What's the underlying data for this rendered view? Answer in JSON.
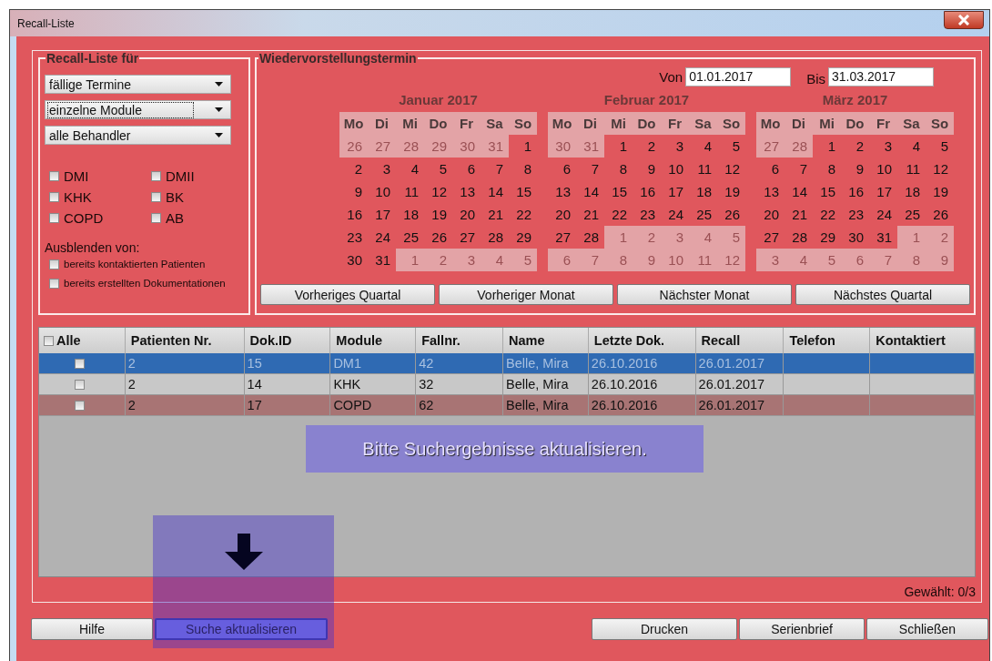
{
  "window": {
    "title": "Recall-Liste"
  },
  "recall_for": {
    "title": "Recall-Liste für",
    "dropdowns": [
      {
        "value": "fällige Termine",
        "focused": false
      },
      {
        "value": "einzelne Module",
        "focused": true
      },
      {
        "value": "alle Behandler",
        "focused": false
      }
    ],
    "modules": [
      {
        "label": "DMI",
        "checked": false
      },
      {
        "label": "DMII",
        "checked": false
      },
      {
        "label": "KHK",
        "checked": false
      },
      {
        "label": "BK",
        "checked": false
      },
      {
        "label": "COPD",
        "checked": false
      },
      {
        "label": "AB",
        "checked": false
      }
    ],
    "hide_label": "Ausblenden von:",
    "hide_options": [
      {
        "label": "bereits kontaktierten Patienten",
        "checked": false
      },
      {
        "label": "bereits erstellten Dokumentationen",
        "checked": false
      }
    ]
  },
  "schedule": {
    "title": "Wiedervorstellungstermin",
    "from_label": "Von",
    "from": "01.01.2017",
    "to_label": "Bis",
    "to": "31.03.2017",
    "months": [
      {
        "title": "Januar 2017",
        "weekdays": [
          "Mo",
          "Di",
          "Mi",
          "Do",
          "Fr",
          "Sa",
          "So"
        ],
        "weeks": [
          [
            {
              "d": "26",
              "in": false
            },
            {
              "d": "27",
              "in": false
            },
            {
              "d": "28",
              "in": false
            },
            {
              "d": "29",
              "in": false
            },
            {
              "d": "30",
              "in": false
            },
            {
              "d": "31",
              "in": false
            },
            {
              "d": "1",
              "in": true
            }
          ],
          [
            {
              "d": "2",
              "in": true
            },
            {
              "d": "3",
              "in": true
            },
            {
              "d": "4",
              "in": true
            },
            {
              "d": "5",
              "in": true
            },
            {
              "d": "6",
              "in": true
            },
            {
              "d": "7",
              "in": true
            },
            {
              "d": "8",
              "in": true
            }
          ],
          [
            {
              "d": "9",
              "in": true
            },
            {
              "d": "10",
              "in": true
            },
            {
              "d": "11",
              "in": true
            },
            {
              "d": "12",
              "in": true
            },
            {
              "d": "13",
              "in": true
            },
            {
              "d": "14",
              "in": true
            },
            {
              "d": "15",
              "in": true
            }
          ],
          [
            {
              "d": "16",
              "in": true
            },
            {
              "d": "17",
              "in": true
            },
            {
              "d": "18",
              "in": true
            },
            {
              "d": "19",
              "in": true
            },
            {
              "d": "20",
              "in": true
            },
            {
              "d": "21",
              "in": true
            },
            {
              "d": "22",
              "in": true
            }
          ],
          [
            {
              "d": "23",
              "in": true
            },
            {
              "d": "24",
              "in": true
            },
            {
              "d": "25",
              "in": true
            },
            {
              "d": "26",
              "in": true
            },
            {
              "d": "27",
              "in": true
            },
            {
              "d": "28",
              "in": true
            },
            {
              "d": "29",
              "in": true
            }
          ],
          [
            {
              "d": "30",
              "in": true
            },
            {
              "d": "31",
              "in": true
            },
            {
              "d": "1",
              "in": false
            },
            {
              "d": "2",
              "in": false
            },
            {
              "d": "3",
              "in": false
            },
            {
              "d": "4",
              "in": false
            },
            {
              "d": "5",
              "in": false
            }
          ]
        ]
      },
      {
        "title": "Februar 2017",
        "weekdays": [
          "Mo",
          "Di",
          "Mi",
          "Do",
          "Fr",
          "Sa",
          "So"
        ],
        "weeks": [
          [
            {
              "d": "30",
              "in": false
            },
            {
              "d": "31",
              "in": false
            },
            {
              "d": "1",
              "in": true
            },
            {
              "d": "2",
              "in": true
            },
            {
              "d": "3",
              "in": true
            },
            {
              "d": "4",
              "in": true
            },
            {
              "d": "5",
              "in": true
            }
          ],
          [
            {
              "d": "6",
              "in": true
            },
            {
              "d": "7",
              "in": true
            },
            {
              "d": "8",
              "in": true
            },
            {
              "d": "9",
              "in": true
            },
            {
              "d": "10",
              "in": true
            },
            {
              "d": "11",
              "in": true
            },
            {
              "d": "12",
              "in": true
            }
          ],
          [
            {
              "d": "13",
              "in": true
            },
            {
              "d": "14",
              "in": true
            },
            {
              "d": "15",
              "in": true
            },
            {
              "d": "16",
              "in": true
            },
            {
              "d": "17",
              "in": true
            },
            {
              "d": "18",
              "in": true
            },
            {
              "d": "19",
              "in": true
            }
          ],
          [
            {
              "d": "20",
              "in": true
            },
            {
              "d": "21",
              "in": true
            },
            {
              "d": "22",
              "in": true
            },
            {
              "d": "23",
              "in": true
            },
            {
              "d": "24",
              "in": true
            },
            {
              "d": "25",
              "in": true
            },
            {
              "d": "26",
              "in": true
            }
          ],
          [
            {
              "d": "27",
              "in": true
            },
            {
              "d": "28",
              "in": true
            },
            {
              "d": "1",
              "in": false
            },
            {
              "d": "2",
              "in": false
            },
            {
              "d": "3",
              "in": false
            },
            {
              "d": "4",
              "in": false
            },
            {
              "d": "5",
              "in": false
            }
          ],
          [
            {
              "d": "6",
              "in": false
            },
            {
              "d": "7",
              "in": false
            },
            {
              "d": "8",
              "in": false
            },
            {
              "d": "9",
              "in": false
            },
            {
              "d": "10",
              "in": false
            },
            {
              "d": "11",
              "in": false
            },
            {
              "d": "12",
              "in": false
            }
          ]
        ]
      },
      {
        "title": "März 2017",
        "weekdays": [
          "Mo",
          "Di",
          "Mi",
          "Do",
          "Fr",
          "Sa",
          "So"
        ],
        "weeks": [
          [
            {
              "d": "27",
              "in": false
            },
            {
              "d": "28",
              "in": false
            },
            {
              "d": "1",
              "in": true
            },
            {
              "d": "2",
              "in": true
            },
            {
              "d": "3",
              "in": true
            },
            {
              "d": "4",
              "in": true
            },
            {
              "d": "5",
              "in": true
            }
          ],
          [
            {
              "d": "6",
              "in": true
            },
            {
              "d": "7",
              "in": true
            },
            {
              "d": "8",
              "in": true
            },
            {
              "d": "9",
              "in": true
            },
            {
              "d": "10",
              "in": true
            },
            {
              "d": "11",
              "in": true
            },
            {
              "d": "12",
              "in": true
            }
          ],
          [
            {
              "d": "13",
              "in": true
            },
            {
              "d": "14",
              "in": true
            },
            {
              "d": "15",
              "in": true
            },
            {
              "d": "16",
              "in": true
            },
            {
              "d": "17",
              "in": true
            },
            {
              "d": "18",
              "in": true
            },
            {
              "d": "19",
              "in": true
            }
          ],
          [
            {
              "d": "20",
              "in": true
            },
            {
              "d": "21",
              "in": true
            },
            {
              "d": "22",
              "in": true
            },
            {
              "d": "23",
              "in": true
            },
            {
              "d": "24",
              "in": true
            },
            {
              "d": "25",
              "in": true
            },
            {
              "d": "26",
              "in": true
            }
          ],
          [
            {
              "d": "27",
              "in": true
            },
            {
              "d": "28",
              "in": true
            },
            {
              "d": "29",
              "in": true
            },
            {
              "d": "30",
              "in": true
            },
            {
              "d": "31",
              "in": true
            },
            {
              "d": "1",
              "in": false
            },
            {
              "d": "2",
              "in": false
            }
          ],
          [
            {
              "d": "3",
              "in": false
            },
            {
              "d": "4",
              "in": false
            },
            {
              "d": "5",
              "in": false
            },
            {
              "d": "6",
              "in": false
            },
            {
              "d": "7",
              "in": false
            },
            {
              "d": "8",
              "in": false
            },
            {
              "d": "9",
              "in": false
            }
          ]
        ]
      }
    ],
    "nav_buttons": [
      "Vorheriges Quartal",
      "Vorheriger Monat",
      "Nächster Monat",
      "Nächstes Quartal"
    ]
  },
  "table": {
    "select_all": {
      "label": "Alle",
      "checked": false
    },
    "columns": [
      "Patienten Nr.",
      "Dok.ID",
      "Module",
      "Fallnr.",
      "Name",
      "Letzte Dok.",
      "Recall",
      "Telefon",
      "Kontaktiert"
    ],
    "rows": [
      {
        "selected": true,
        "flagged": false,
        "checked": false,
        "cells": [
          "2",
          "15",
          "DM1",
          "42",
          "Belle, Mira",
          "26.10.2016",
          "26.01.2017"
        ]
      },
      {
        "selected": false,
        "flagged": false,
        "checked": false,
        "cells": [
          "2",
          "14",
          "KHK",
          "32",
          "Belle, Mira",
          "26.10.2016",
          "26.01.2017"
        ]
      },
      {
        "selected": false,
        "flagged": true,
        "checked": false,
        "cells": [
          "2",
          "17",
          "COPD",
          "62",
          "Belle, Mira",
          "26.10.2016",
          "26.01.2017"
        ]
      }
    ],
    "message": "Bitte Suchergebnisse aktualisieren."
  },
  "selected_count": "Gewählt: 0/3",
  "buttons_left": [
    {
      "label": "Hilfe",
      "highlighted": false
    },
    {
      "label": "Suche aktualisieren",
      "highlighted": true
    }
  ],
  "buttons_right": [
    {
      "label": "Drucken",
      "highlighted": false
    },
    {
      "label": "Serienbrief",
      "highlighted": false
    },
    {
      "label": "Schließen",
      "highlighted": false
    }
  ]
}
